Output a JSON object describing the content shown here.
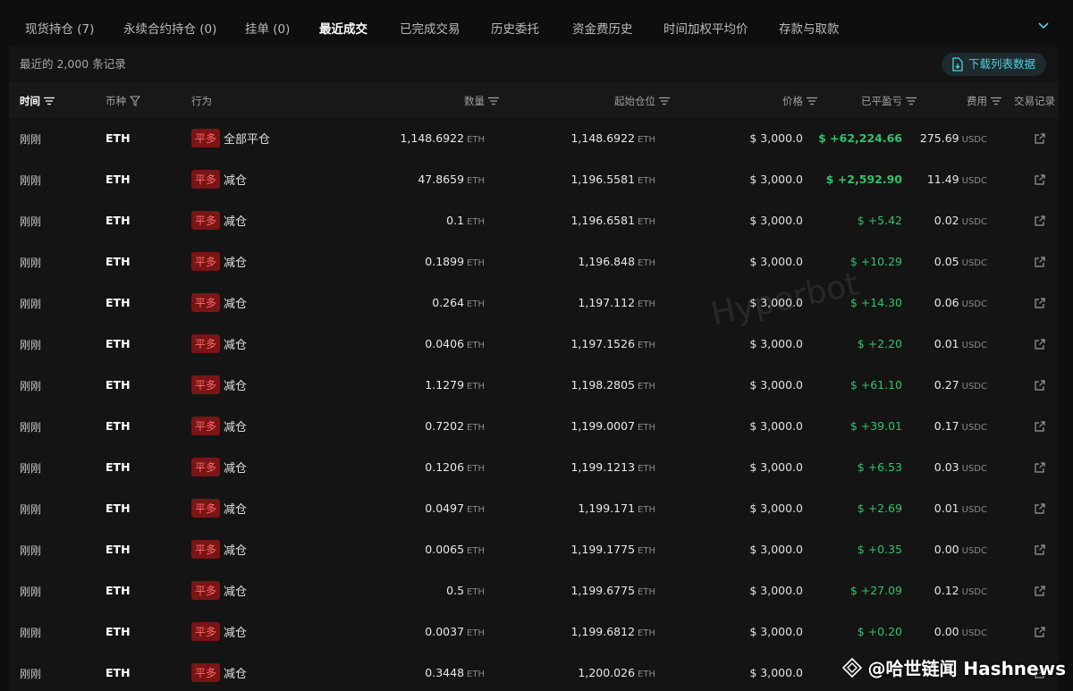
{
  "tabs": [
    {
      "label": "现货持仓 (7)",
      "active": false
    },
    {
      "label": "永续合约持仓 (0)",
      "active": false
    },
    {
      "label": "挂单 (0)",
      "active": false
    },
    {
      "label": "最近成交",
      "active": true
    },
    {
      "label": "已完成交易",
      "active": false
    },
    {
      "label": "历史委托",
      "active": false
    },
    {
      "label": "资金费历史",
      "active": false
    },
    {
      "label": "时间加权平均价",
      "active": false
    },
    {
      "label": "存款与取款",
      "active": false
    }
  ],
  "record_count": "最近的 2,000 条记录",
  "download_label": "下载列表数据",
  "columns": {
    "time": "时间",
    "coin": "币种",
    "action": "行为",
    "qty": "数量",
    "start": "起始仓位",
    "price": "价格",
    "pnl": "已平盈亏",
    "fee": "费用",
    "record": "交易记录"
  },
  "units": {
    "eth": "ETH",
    "usdc": "USDC"
  },
  "rows": [
    {
      "time": "刚刚",
      "coin": "ETH",
      "side": "平多",
      "action": "全部平仓",
      "qty": "1,148.6922",
      "start": "1,148.6922",
      "price": "$ 3,000.0",
      "pnl": "$ +62,224.66",
      "fee": "275.69"
    },
    {
      "time": "刚刚",
      "coin": "ETH",
      "side": "平多",
      "action": "减仓",
      "qty": "47.8659",
      "start": "1,196.5581",
      "price": "$ 3,000.0",
      "pnl": "$ +2,592.90",
      "fee": "11.49"
    },
    {
      "time": "刚刚",
      "coin": "ETH",
      "side": "平多",
      "action": "减仓",
      "qty": "0.1",
      "start": "1,196.6581",
      "price": "$ 3,000.0",
      "pnl": "$ +5.42",
      "fee": "0.02"
    },
    {
      "time": "刚刚",
      "coin": "ETH",
      "side": "平多",
      "action": "减仓",
      "qty": "0.1899",
      "start": "1,196.848",
      "price": "$ 3,000.0",
      "pnl": "$ +10.29",
      "fee": "0.05"
    },
    {
      "time": "刚刚",
      "coin": "ETH",
      "side": "平多",
      "action": "减仓",
      "qty": "0.264",
      "start": "1,197.112",
      "price": "$ 3,000.0",
      "pnl": "$ +14.30",
      "fee": "0.06"
    },
    {
      "time": "刚刚",
      "coin": "ETH",
      "side": "平多",
      "action": "减仓",
      "qty": "0.0406",
      "start": "1,197.1526",
      "price": "$ 3,000.0",
      "pnl": "$ +2.20",
      "fee": "0.01"
    },
    {
      "time": "刚刚",
      "coin": "ETH",
      "side": "平多",
      "action": "减仓",
      "qty": "1.1279",
      "start": "1,198.2805",
      "price": "$ 3,000.0",
      "pnl": "$ +61.10",
      "fee": "0.27"
    },
    {
      "time": "刚刚",
      "coin": "ETH",
      "side": "平多",
      "action": "减仓",
      "qty": "0.7202",
      "start": "1,199.0007",
      "price": "$ 3,000.0",
      "pnl": "$ +39.01",
      "fee": "0.17"
    },
    {
      "time": "刚刚",
      "coin": "ETH",
      "side": "平多",
      "action": "减仓",
      "qty": "0.1206",
      "start": "1,199.1213",
      "price": "$ 3,000.0",
      "pnl": "$ +6.53",
      "fee": "0.03"
    },
    {
      "time": "刚刚",
      "coin": "ETH",
      "side": "平多",
      "action": "减仓",
      "qty": "0.0497",
      "start": "1,199.171",
      "price": "$ 3,000.0",
      "pnl": "$ +2.69",
      "fee": "0.01"
    },
    {
      "time": "刚刚",
      "coin": "ETH",
      "side": "平多",
      "action": "减仓",
      "qty": "0.0065",
      "start": "1,199.1775",
      "price": "$ 3,000.0",
      "pnl": "$ +0.35",
      "fee": "0.00"
    },
    {
      "time": "刚刚",
      "coin": "ETH",
      "side": "平多",
      "action": "减仓",
      "qty": "0.5",
      "start": "1,199.6775",
      "price": "$ 3,000.0",
      "pnl": "$ +27.09",
      "fee": "0.12"
    },
    {
      "time": "刚刚",
      "coin": "ETH",
      "side": "平多",
      "action": "减仓",
      "qty": "0.0037",
      "start": "1,199.6812",
      "price": "$ 3,000.0",
      "pnl": "$ +0.20",
      "fee": "0.00"
    },
    {
      "time": "刚刚",
      "coin": "ETH",
      "side": "平多",
      "action": "减仓",
      "qty": "0.3448",
      "start": "1,200.026",
      "price": "$ 3,000.0",
      "pnl": "",
      "fee": ""
    }
  ],
  "watermark": "Hyperbot",
  "brand": "@哈世链闻 Hashnews",
  "colors": {
    "accent": "#4fd0e0",
    "profit": "#2fc36b",
    "badge_bg": "#7a1515",
    "badge_text": "#ff6a6a"
  }
}
